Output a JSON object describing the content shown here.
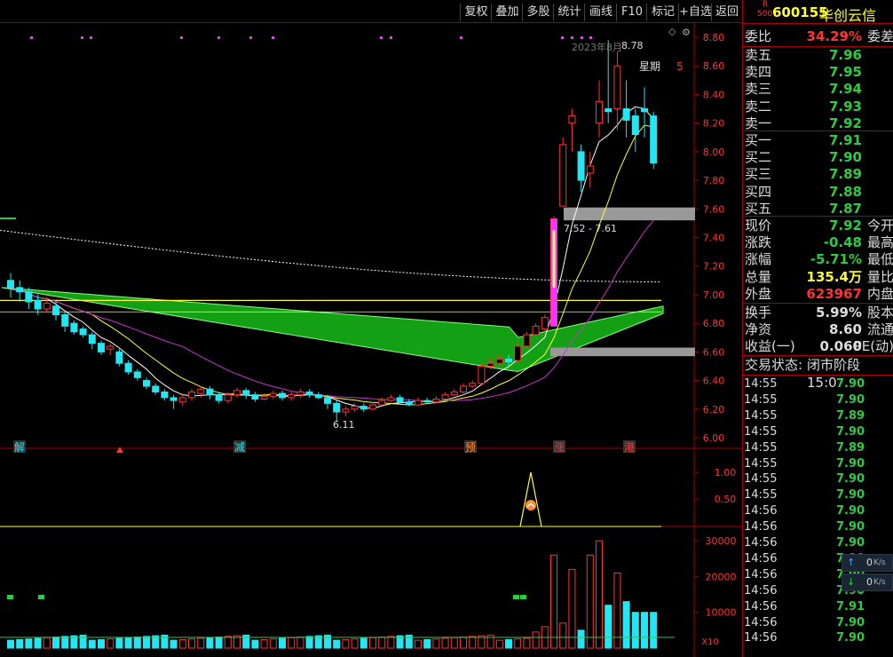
{
  "toolbar": {
    "buttons": [
      "复权",
      "叠加",
      "多股",
      "统计",
      "画线",
      "F10",
      "标记",
      "+自选",
      "返回"
    ]
  },
  "stock": {
    "badge_r": "R",
    "badge_500": "500",
    "code": "600155",
    "name": "华创云信"
  },
  "chart": {
    "date_label": "2023年8月",
    "high_label": "8.78",
    "weekday_label": "星期",
    "weekday_value": "5",
    "range_label": "7.52 - 7.61",
    "low_label": "6.11",
    "price_ticks": [
      "8.80",
      "8.60",
      "8.40",
      "8.20",
      "8.00",
      "7.80",
      "7.60",
      "7.40",
      "7.20",
      "7.00",
      "6.80",
      "6.60",
      "6.40",
      "6.20",
      "6.00"
    ],
    "markers": [
      "解",
      "减",
      "预",
      "涨",
      "港"
    ],
    "ind_ticks": [
      "1.00",
      "0.50"
    ],
    "vol_ticks": [
      "30000",
      "20000",
      "10000"
    ],
    "vol_unit": "X10"
  },
  "chart_data": {
    "type": "candlestick",
    "candles": [
      [
        7.1,
        7.05,
        7.15,
        6.98
      ],
      [
        7.05,
        7.02,
        7.1,
        6.95
      ],
      [
        7.02,
        6.95,
        7.05,
        6.9
      ],
      [
        6.96,
        6.9,
        7.0,
        6.86
      ],
      [
        6.9,
        6.94,
        6.98,
        6.88
      ],
      [
        6.92,
        6.86,
        6.95,
        6.82
      ],
      [
        6.86,
        6.78,
        6.88,
        6.74
      ],
      [
        6.8,
        6.74,
        6.82,
        6.72
      ],
      [
        6.76,
        6.72,
        6.78,
        6.7
      ],
      [
        6.72,
        6.66,
        6.74,
        6.62
      ],
      [
        6.66,
        6.6,
        6.68,
        6.58
      ],
      [
        6.62,
        6.64,
        6.66,
        6.58
      ],
      [
        6.6,
        6.52,
        6.62,
        6.5
      ],
      [
        6.52,
        6.46,
        6.54,
        6.44
      ],
      [
        6.46,
        6.42,
        6.48,
        6.4
      ],
      [
        6.4,
        6.36,
        6.42,
        6.34
      ],
      [
        6.36,
        6.32,
        6.38,
        6.3
      ],
      [
        6.32,
        6.28,
        6.34,
        6.26
      ],
      [
        6.28,
        6.26,
        6.3,
        6.2
      ],
      [
        6.25,
        6.28,
        6.3,
        6.22
      ],
      [
        6.28,
        6.32,
        6.34,
        6.26
      ],
      [
        6.31,
        6.34,
        6.36,
        6.28
      ],
      [
        6.34,
        6.3,
        6.36,
        6.27
      ],
      [
        6.3,
        6.26,
        6.32,
        6.24
      ],
      [
        6.26,
        6.3,
        6.32,
        6.24
      ],
      [
        6.3,
        6.33,
        6.35,
        6.28
      ],
      [
        6.33,
        6.3,
        6.35,
        6.27
      ],
      [
        6.3,
        6.27,
        6.32,
        6.25
      ],
      [
        6.27,
        6.29,
        6.31,
        6.26
      ],
      [
        6.29,
        6.31,
        6.33,
        6.27
      ],
      [
        6.31,
        6.28,
        6.33,
        6.26
      ],
      [
        6.28,
        6.3,
        6.32,
        6.26
      ],
      [
        6.3,
        6.32,
        6.34,
        6.28
      ],
      [
        6.32,
        6.3,
        6.34,
        6.28
      ],
      [
        6.3,
        6.28,
        6.32,
        6.27
      ],
      [
        6.28,
        6.24,
        6.3,
        6.2
      ],
      [
        6.24,
        6.18,
        6.26,
        6.11
      ],
      [
        6.18,
        6.2,
        6.22,
        6.15
      ],
      [
        6.2,
        6.22,
        6.24,
        6.18
      ],
      [
        6.22,
        6.2,
        6.24,
        6.18
      ],
      [
        6.2,
        6.23,
        6.25,
        6.19
      ],
      [
        6.23,
        6.26,
        6.28,
        6.22
      ],
      [
        6.26,
        6.28,
        6.3,
        6.25
      ],
      [
        6.28,
        6.25,
        6.3,
        6.24
      ],
      [
        6.25,
        6.23,
        6.27,
        6.22
      ],
      [
        6.23,
        6.26,
        6.28,
        6.22
      ],
      [
        6.26,
        6.25,
        6.28,
        6.24
      ],
      [
        6.25,
        6.27,
        6.29,
        6.24
      ],
      [
        6.27,
        6.3,
        6.32,
        6.26
      ],
      [
        6.3,
        6.32,
        6.34,
        6.29
      ],
      [
        6.32,
        6.36,
        6.38,
        6.31
      ],
      [
        6.36,
        6.38,
        6.4,
        6.35
      ],
      [
        6.38,
        6.5,
        6.52,
        6.37
      ],
      [
        6.5,
        6.52,
        6.56,
        6.48
      ],
      [
        6.52,
        6.55,
        6.58,
        6.5
      ],
      [
        6.55,
        6.53,
        6.58,
        6.5
      ],
      [
        6.54,
        6.64,
        6.68,
        6.52
      ],
      [
        6.64,
        6.72,
        6.74,
        6.6
      ],
      [
        6.72,
        6.78,
        6.8,
        6.7
      ],
      [
        6.76,
        6.84,
        6.86,
        6.74
      ],
      [
        6.78,
        7.53,
        7.55,
        6.78
      ],
      [
        7.62,
        8.05,
        8.1,
        7.62
      ],
      [
        8.2,
        8.25,
        8.3,
        8.0
      ],
      [
        8.0,
        7.8,
        8.05,
        7.72
      ],
      [
        7.85,
        7.9,
        8.0,
        7.75
      ],
      [
        8.2,
        8.35,
        8.5,
        8.1
      ],
      [
        8.3,
        8.28,
        8.78,
        8.2
      ],
      [
        8.3,
        8.6,
        8.7,
        8.15
      ],
      [
        8.3,
        8.22,
        8.5,
        8.1
      ],
      [
        8.25,
        8.12,
        8.3,
        8.0
      ],
      [
        8.3,
        8.28,
        8.45,
        8.1
      ],
      [
        8.25,
        7.92,
        8.28,
        7.88
      ]
    ],
    "ylim": [
      6.0,
      8.8
    ]
  },
  "quote": {
    "weibi_label": "委比",
    "weibi_value": "34.29%",
    "weicha_label": "委差",
    "asks": [
      {
        "label": "卖五",
        "value": "7.96"
      },
      {
        "label": "卖四",
        "value": "7.95"
      },
      {
        "label": "卖三",
        "value": "7.94"
      },
      {
        "label": "卖二",
        "value": "7.93"
      },
      {
        "label": "卖一",
        "value": "7.92"
      }
    ],
    "bids": [
      {
        "label": "买一",
        "value": "7.91"
      },
      {
        "label": "买二",
        "value": "7.90"
      },
      {
        "label": "买三",
        "value": "7.89"
      },
      {
        "label": "买四",
        "value": "7.88"
      },
      {
        "label": "买五",
        "value": "7.87"
      }
    ],
    "stats": [
      {
        "label": "现价",
        "value": "7.92",
        "right": "今开",
        "color": "#2ecc40"
      },
      {
        "label": "涨跌",
        "value": "-0.48",
        "right": "最高",
        "color": "#2ecc40"
      },
      {
        "label": "涨幅",
        "value": "-5.71%",
        "right": "最低",
        "color": "#2ecc40"
      },
      {
        "label": "总量",
        "value": "135.4万",
        "right": "量比",
        "color": "#ffff33"
      },
      {
        "label": "外盘",
        "value": "623967",
        "right": "内盘",
        "color": "#ff3333"
      }
    ],
    "stats2": [
      {
        "label": "换手",
        "value": "5.99%",
        "right": "股本",
        "color": "#dddddd"
      },
      {
        "label": "净资",
        "value": "8.60",
        "right": "流通",
        "color": "#dddddd"
      },
      {
        "label": "收益(一)",
        "value": "0.060",
        "right": "PE(动)",
        "color": "#dddddd"
      }
    ],
    "status_label": "交易状态:",
    "status_value": "闭市阶段 15:0",
    "ticks": [
      [
        "14:55",
        "7.90"
      ],
      [
        "14:55",
        "7.90"
      ],
      [
        "14:55",
        "7.89"
      ],
      [
        "14:55",
        "7.90"
      ],
      [
        "14:55",
        "7.89"
      ],
      [
        "14:55",
        "7.90"
      ],
      [
        "14:55",
        "7.90"
      ],
      [
        "14:55",
        "7.90"
      ],
      [
        "14:56",
        "7.90"
      ],
      [
        "14:56",
        "7.90"
      ],
      [
        "14:56",
        "7.90"
      ],
      [
        "14:56",
        "7.90"
      ],
      [
        "14:56",
        "7.90"
      ],
      [
        "14:56",
        "7.90"
      ],
      [
        "14:56",
        "7.91"
      ],
      [
        "14:56",
        "7.90"
      ],
      [
        "14:56",
        "7.90"
      ]
    ],
    "speed_up": "0",
    "speed_down": "0",
    "speed_unit": "K/s"
  }
}
